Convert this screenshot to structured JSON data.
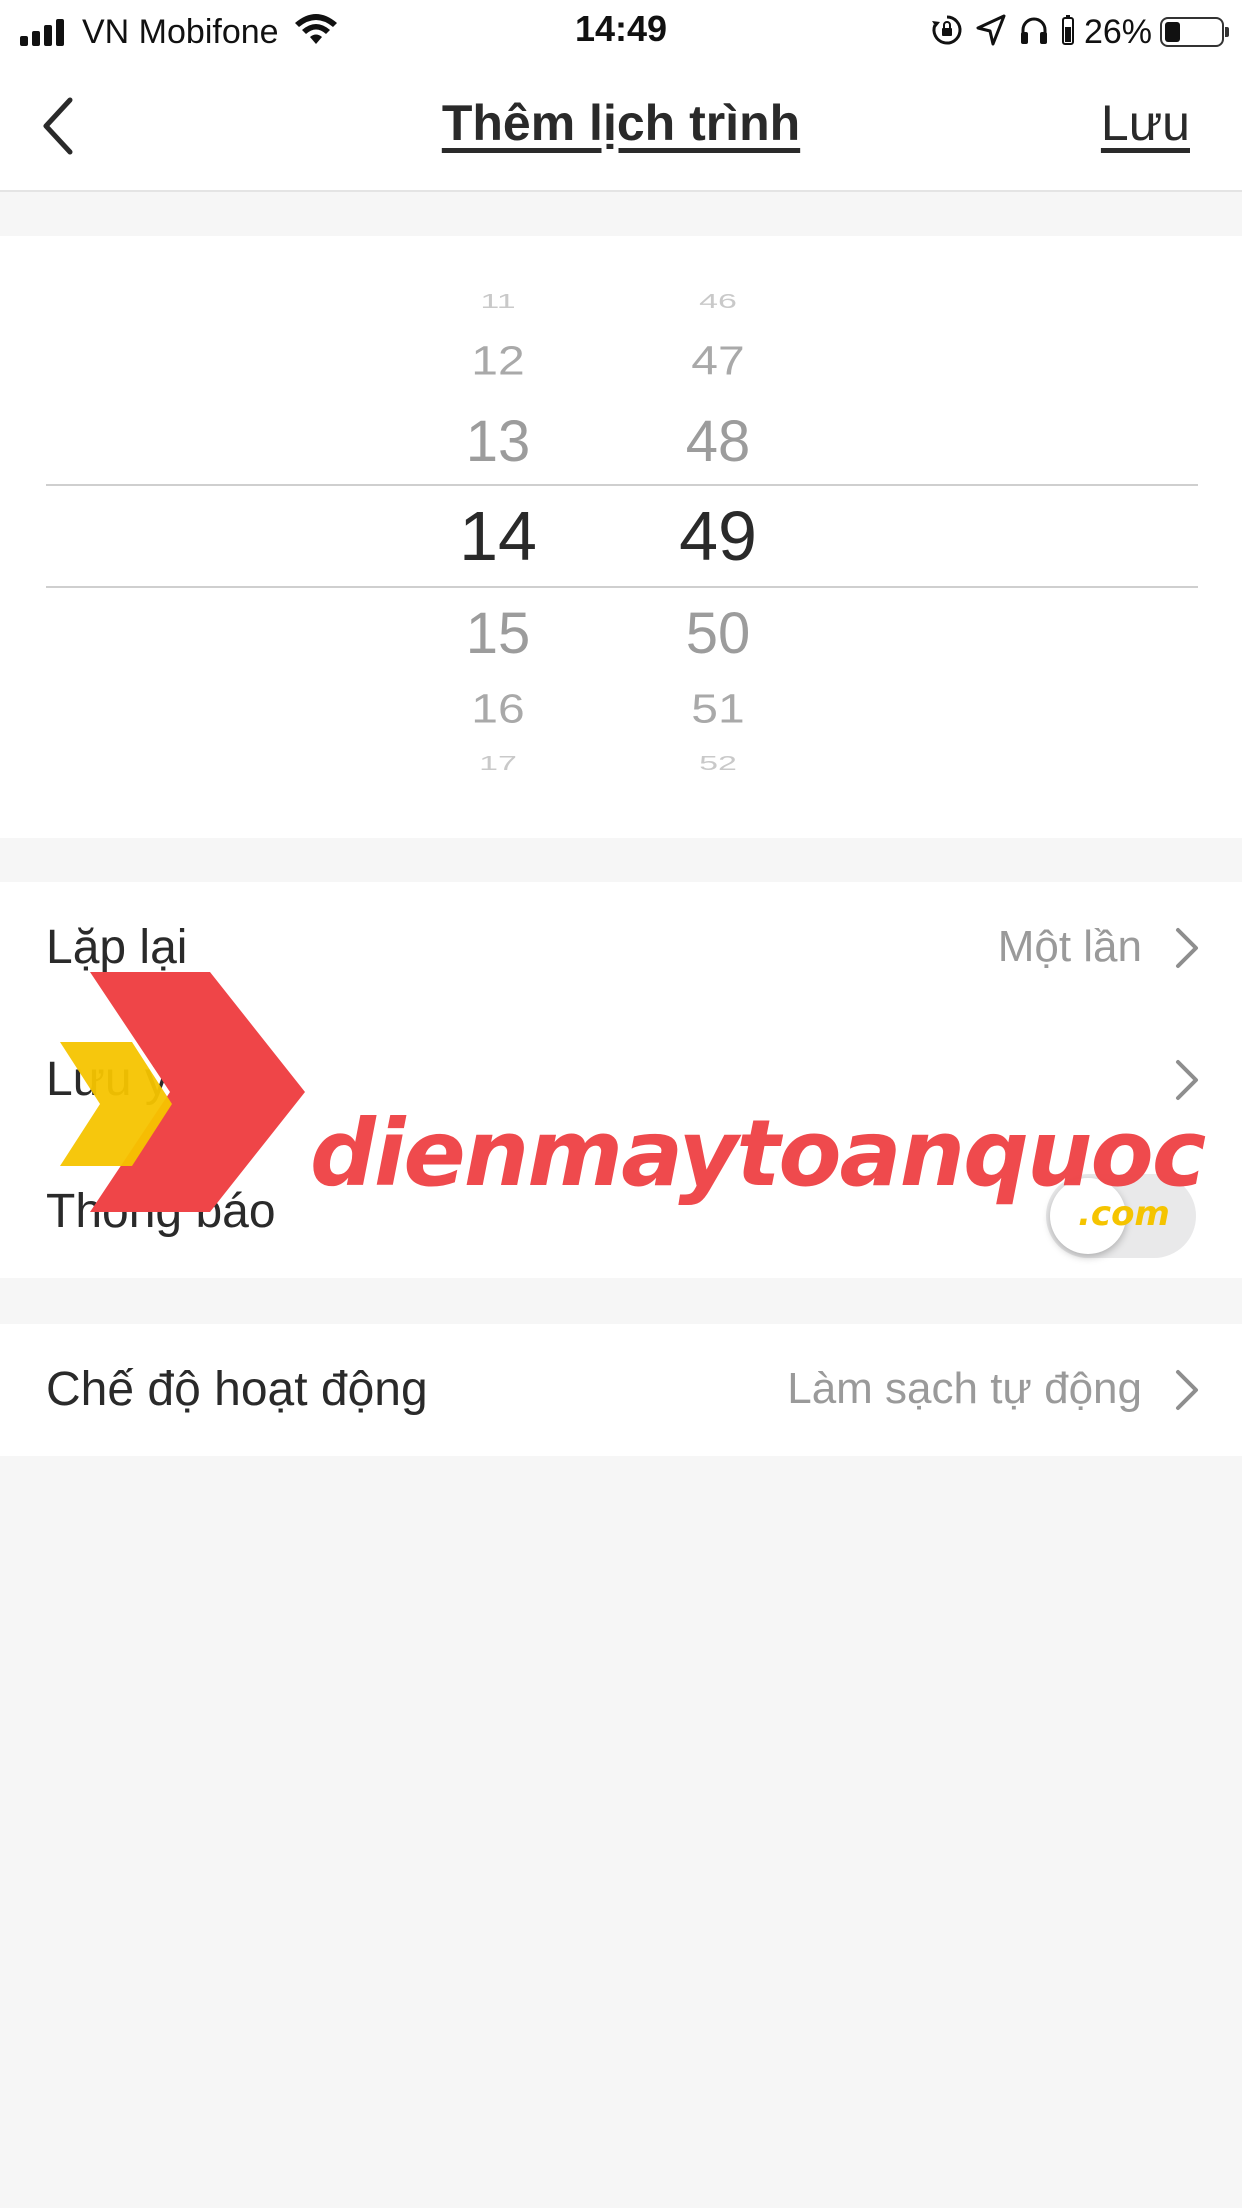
{
  "status_bar": {
    "carrier": "VN Mobifone",
    "time": "14:49",
    "battery_percent": "26%",
    "battery_level": 0.26,
    "icons": [
      "signal-icon",
      "wifi-icon",
      "orientation-lock-icon",
      "location-icon",
      "headphones-icon",
      "battery-icon"
    ]
  },
  "nav": {
    "title": "Thêm lịch trình",
    "save_label": "Lưu",
    "back_icon": "chevron-left-icon"
  },
  "time_picker": {
    "hours": [
      "11",
      "12",
      "13",
      "14",
      "15",
      "16",
      "17"
    ],
    "minutes": [
      "46",
      "47",
      "48",
      "49",
      "50",
      "51",
      "52"
    ],
    "selected_hour": "14",
    "selected_minute": "49"
  },
  "settings": {
    "repeat": {
      "label": "Lặp lại",
      "value": "Một lần"
    },
    "note": {
      "label": "Lưu ý"
    },
    "notification": {
      "label": "Thông báo",
      "enabled": false
    },
    "mode": {
      "label": "Chế độ hoạt động",
      "value": "Làm sạch tự động"
    }
  },
  "watermark": {
    "text": "dienmaytoanquoc",
    "suffix": ".com",
    "colors": {
      "red": "#ef4548",
      "yellow": "#f5c400"
    }
  },
  "colors": {
    "background": "#f6f6f6",
    "card": "#ffffff",
    "text": "#2a2a2a",
    "secondary_text": "#9a9a9a",
    "separator": "#cfcfcf"
  }
}
